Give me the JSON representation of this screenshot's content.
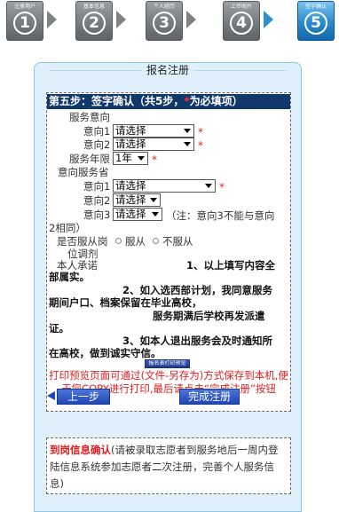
{
  "steps": [
    {
      "num": "1",
      "label": "注册用户",
      "active": false
    },
    {
      "num": "2",
      "label": "基本信息",
      "active": false
    },
    {
      "num": "3",
      "label": "个人经历",
      "active": false
    },
    {
      "num": "4",
      "label": "上传照片",
      "active": false
    },
    {
      "num": "5",
      "label": "签字确认",
      "active": true
    }
  ],
  "panel": {
    "title": "报名注册"
  },
  "form": {
    "header_main": "第五步：签字确认（共5步，",
    "header_star": "*",
    "header_tail": "为必填项）",
    "service_intent_label": "服务意向",
    "intent1_label": "意向1",
    "intent1_value": "请选择",
    "intent2_label": "意向2",
    "intent2_value": "请选择",
    "years_label": "服务年限",
    "years_value": "1年",
    "province_label": "意向服务省",
    "prov1_label": "意向1",
    "prov1_value": "请选择",
    "prov2_label": "意向2",
    "prov2_value": "请选择",
    "prov3_label": "意向3",
    "prov3_value": "请选择",
    "prov_note_a": "（注：意向3不能与意向",
    "prov_note_b": "2相同）",
    "obey_label_a": "是否服从岗",
    "obey_label_b": "位调剂",
    "obey_yes": "服从",
    "obey_no": "不服从",
    "commit_label": "本人承诺",
    "commit_1a": "1、以上填写内容全",
    "commit_1b": "部属实。",
    "commit_2a": "2、如入选西部计划，我同意服务",
    "commit_2b": "期间户口、档案保留在毕业高校，",
    "commit_2c": "服务期满后学校再发派遣",
    "commit_2d": "证。",
    "commit_3a": "3、如本人退出服务会及时通知所",
    "commit_3b": "在高校，做到诚实守信。",
    "print_button": "报名表打印预览",
    "print_note": "打印预览页面可通过(文件-另存为)方式保存到本机,便于您COPY进行打印,最后请点击“完成注册”按钮",
    "prev_button": "上一步",
    "finish_button": "完成注册"
  },
  "info": {
    "highlight": "到岗信息确认",
    "text": "(请被录取志愿者到服务地后一周内登陆信息系统参加志愿者二次注册，完善个人服务信息)"
  },
  "colors": {
    "header_bg": "#11386a",
    "panel_bg": "#dff0fb",
    "required": "#e11d1d",
    "button": "#1f47b6",
    "step_active": "#2f8fd0",
    "step_inactive": "#7c8286"
  }
}
